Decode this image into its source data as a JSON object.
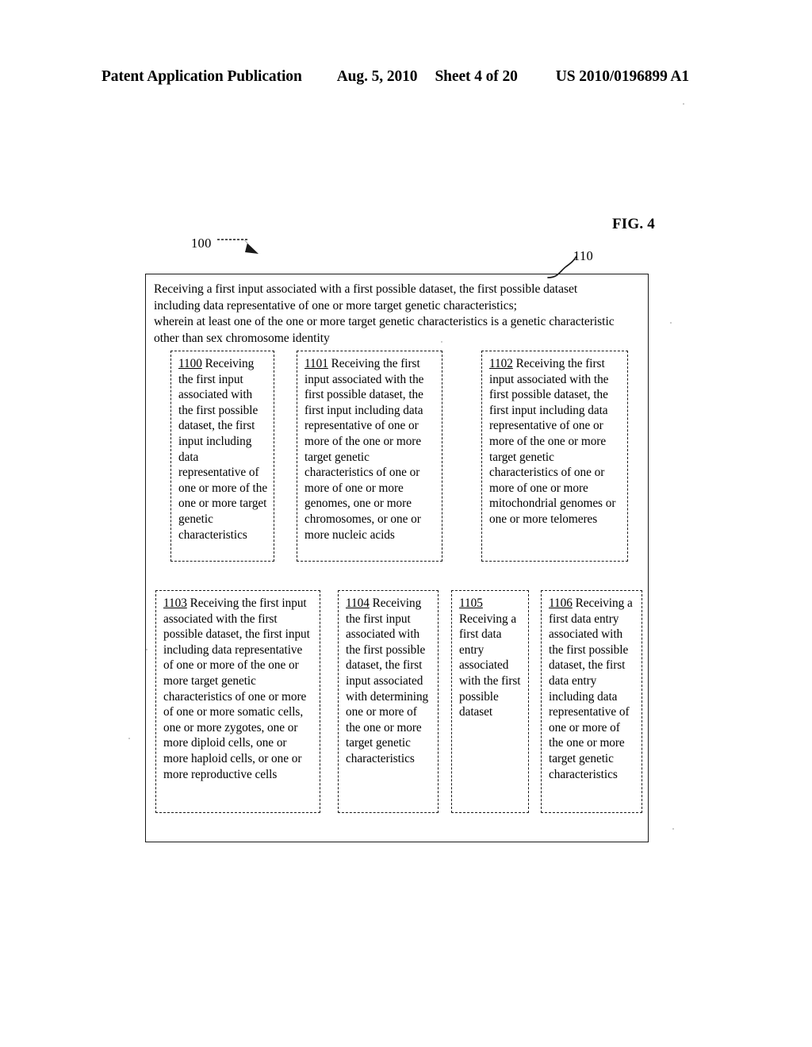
{
  "header": {
    "publication": "Patent Application Publication",
    "date": "Aug. 5, 2010",
    "sheet": "Sheet 4 of 20",
    "patent_number": "US 2010/0196899 A1"
  },
  "figure": {
    "label": "FIG. 4",
    "ref_diagram": "100",
    "ref_block": "110"
  },
  "statement": {
    "line1": "Receiving a first input associated with a first possible dataset, the first possible dataset",
    "line2": "including data representative of one or more target genetic characteristics;",
    "line3": "wherein at least one of the one or more target genetic characteristics is a genetic characteristic",
    "line4": "other than sex chromosome identity"
  },
  "boxes": [
    {
      "id": "1100",
      "number": "1100",
      "text": " Receiving the first input associated with the first possible dataset, the first input including data representative of one or more of the one or more target genetic characteristics"
    },
    {
      "id": "1101",
      "number": "1101",
      "text": " Receiving the first input associated with the first possible dataset, the first input including data representative of one or more of the one or more target genetic characteristics of one or more of one or more genomes, one or more chromosomes, or one or more nucleic acids"
    },
    {
      "id": "1102",
      "number": "1102",
      "text": " Receiving the first input associated with the first possible dataset, the first input including data representative of one or more of the one or more target genetic characteristics of one or more of one or more mitochondrial genomes or one or more telomeres"
    },
    {
      "id": "1103",
      "number": "1103",
      "text": " Receiving the first input associated with the first possible dataset, the first input including data representative of one or more of the one or more target genetic characteristics of one or more of one or more somatic cells, one or more zygotes, one or more diploid cells, one or more haploid cells, or one or more reproductive cells"
    },
    {
      "id": "1104",
      "number": "1104",
      "text": " Receiving the first input associated with the first possible dataset, the first input associated with determining one or more of the one or more target genetic characteristics"
    },
    {
      "id": "1105",
      "number": "1105",
      "text": " Receiving a first data entry associated with the first possible dataset"
    },
    {
      "id": "1106",
      "number": "1106",
      "text": " Receiving a first data entry associated with the first possible dataset, the first data entry including data representative of one or more of the one or more target genetic characteristics"
    }
  ]
}
